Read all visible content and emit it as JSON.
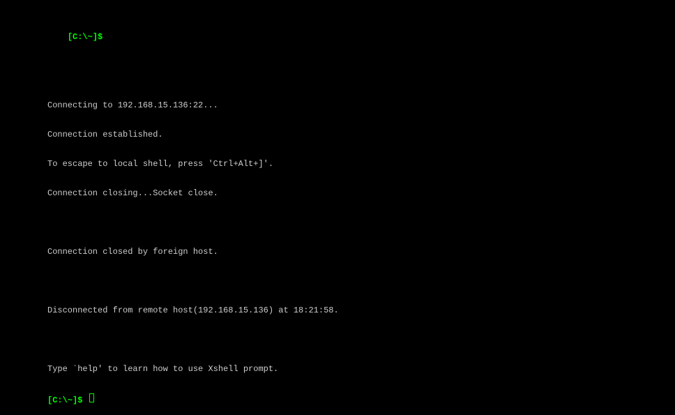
{
  "terminal": {
    "prompt1": "[C:\\~]$ ",
    "lines": [
      "Connecting to 192.168.15.136:22...",
      "Connection established.",
      "To escape to local shell, press 'Ctrl+Alt+]'.",
      "Connection closing...Socket close.",
      "",
      "Connection closed by foreign host.",
      "",
      "Disconnected from remote host(192.168.15.136) at 18:21:58.",
      "",
      "Type `help' to learn how to use Xshell prompt."
    ],
    "prompt2": "[C:\\~]$ "
  }
}
